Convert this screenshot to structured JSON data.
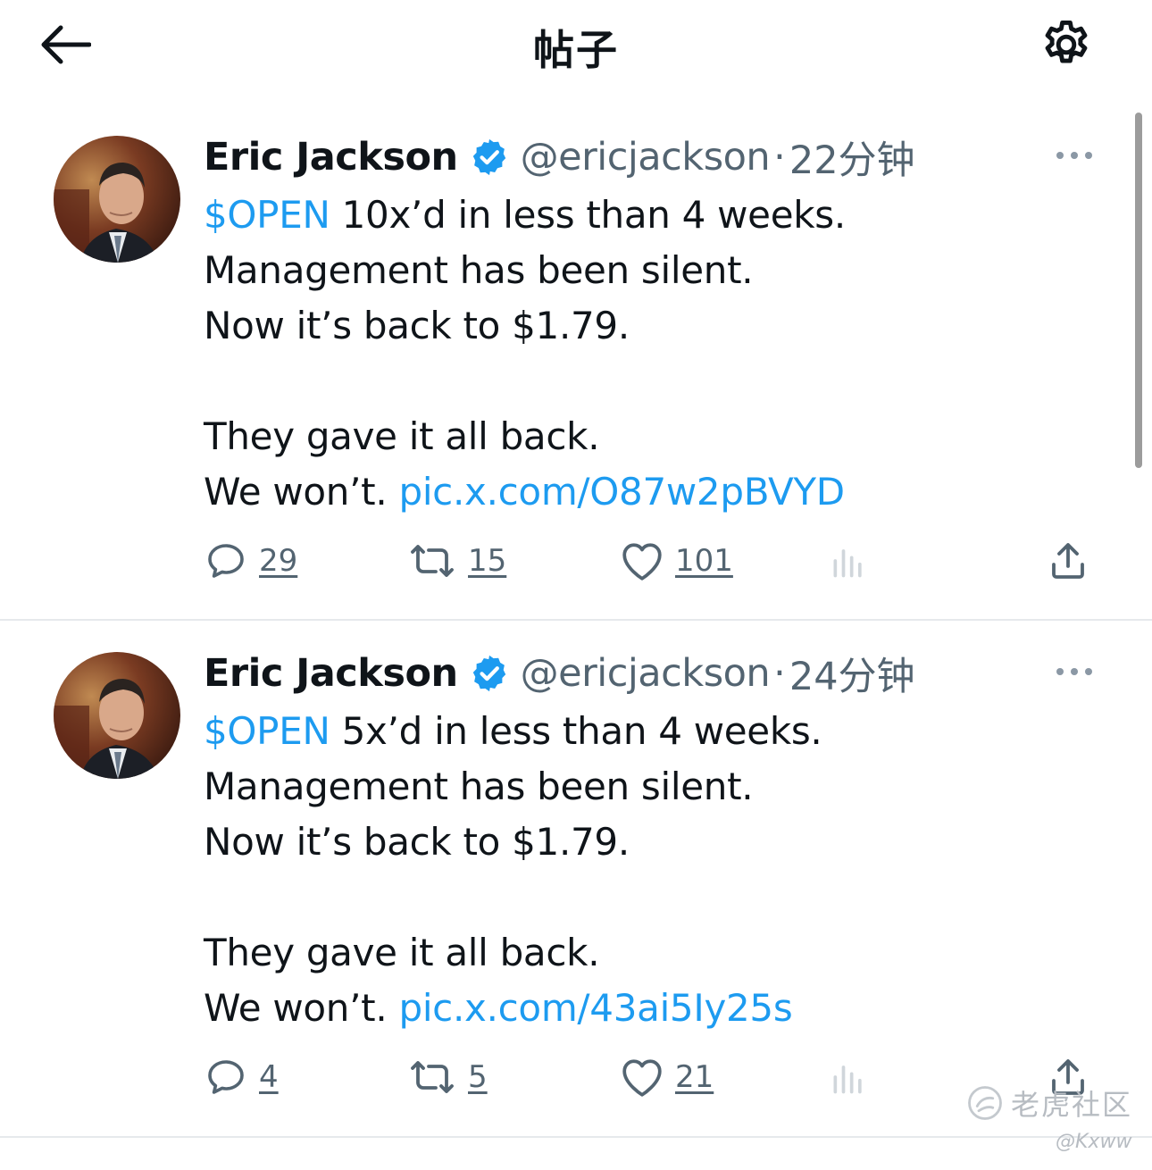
{
  "header": {
    "title": "帖子",
    "back_icon": "arrow-left-icon",
    "settings_icon": "gear-icon"
  },
  "colors": {
    "link": "#1d9bf0",
    "text": "#0f1419",
    "secondary": "#536471",
    "verified": "#1d9bf0"
  },
  "tweets": [
    {
      "author": "Eric Jackson",
      "handle": "@ericjackson",
      "separator": "·",
      "time": "22分钟",
      "cashtag": "$OPEN",
      "first_line": " 10x’d in less than 4 weeks.",
      "line2": "Management has been silent.",
      "line3": "Now it’s back to $1.79.",
      "line4": "They gave it all back.",
      "line5_prefix": "We won’t. ",
      "link": "pic.x.com/O87w2pBVYD",
      "replies": "29",
      "retweets": "15",
      "likes": "101"
    },
    {
      "author": "Eric Jackson",
      "handle": "@ericjackson",
      "separator": "·",
      "time": "24分钟",
      "cashtag": "$OPEN",
      "first_line": " 5x’d in less than 4 weeks.",
      "line2": "Management has been silent.",
      "line3": "Now it’s back to $1.79.",
      "line4": "They gave it all back.",
      "line5_prefix": "We won’t. ",
      "link": "pic.x.com/43ai5Iy25s",
      "replies": "4",
      "retweets": "5",
      "likes": "21"
    }
  ],
  "watermark": {
    "brand": "老虎社区",
    "handle": "@Kxww"
  }
}
